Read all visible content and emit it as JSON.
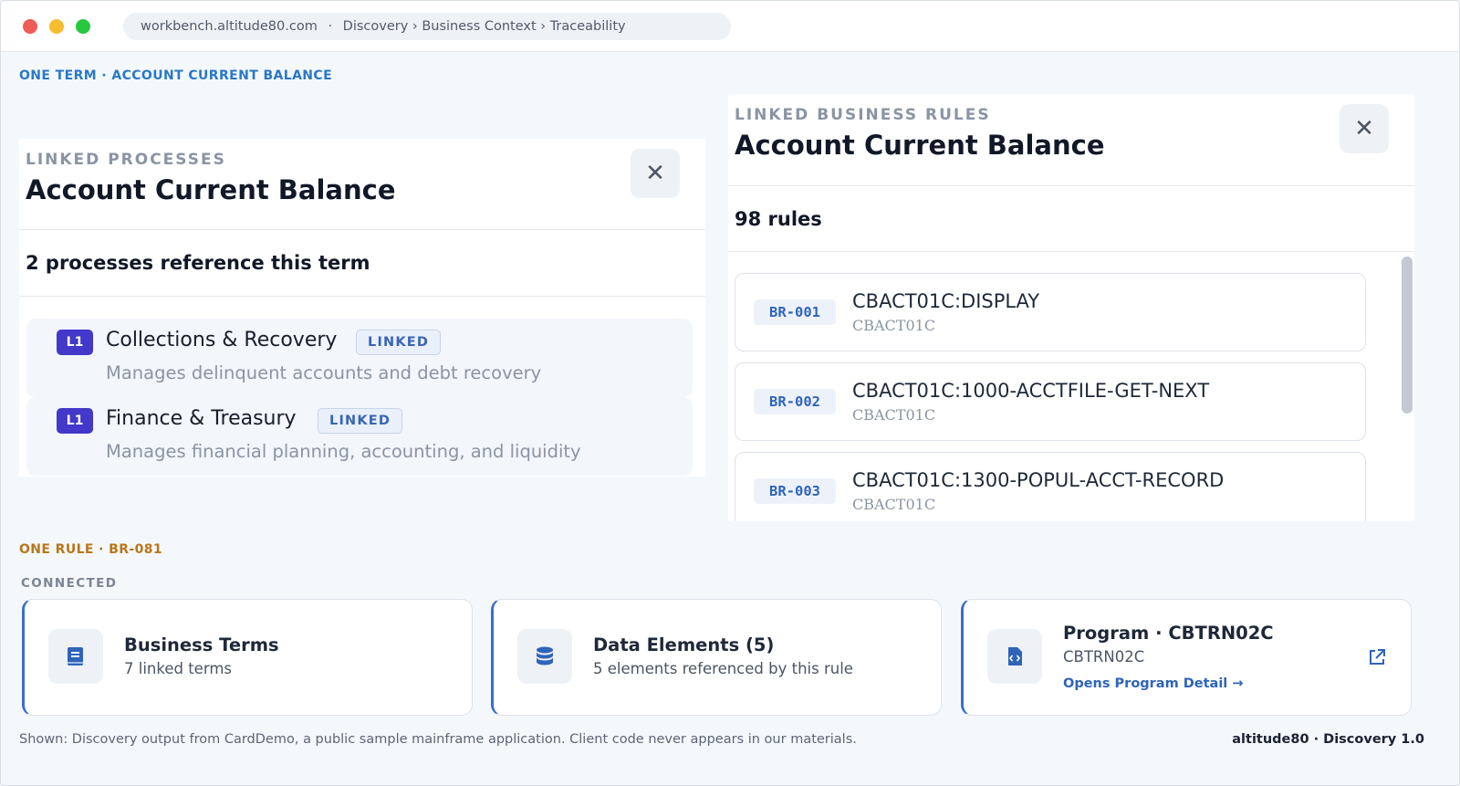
{
  "window": {
    "url": "workbench.altitude80.com",
    "separator": "·",
    "breadcrumb": "Discovery › Business Context › Traceability"
  },
  "term_section": {
    "label": "ONE TERM · ACCOUNT CURRENT BALANCE"
  },
  "processes_panel": {
    "eyebrow": "LINKED PROCESSES",
    "title": "Account Current Balance",
    "close": "✕",
    "count": "2 processes reference this term",
    "items": [
      {
        "level": "L1",
        "name": "Collections & Recovery",
        "badge": "LINKED",
        "description": "Manages delinquent accounts and debt recovery"
      },
      {
        "level": "L1",
        "name": "Finance & Treasury",
        "badge": "LINKED",
        "description": "Manages financial planning, accounting, and liquidity"
      }
    ]
  },
  "rules_panel": {
    "eyebrow": "LINKED BUSINESS RULES",
    "title": "Account Current Balance",
    "close": "✕",
    "count": "98 rules",
    "items": [
      {
        "id": "BR-001",
        "name": "CBACT01C:DISPLAY",
        "program": "CBACT01C"
      },
      {
        "id": "BR-002",
        "name": "CBACT01C:1000-ACCTFILE-GET-NEXT",
        "program": "CBACT01C"
      },
      {
        "id": "BR-003",
        "name": "CBACT01C:1300-POPUL-ACCT-RECORD",
        "program": "CBACT01C"
      }
    ]
  },
  "rule_section": {
    "label": "ONE RULE · BR-081",
    "connected_label": "CONNECTED",
    "cards": [
      {
        "icon": "book-icon",
        "title": "Business Terms",
        "subtitle": "7 linked terms"
      },
      {
        "icon": "database-icon",
        "title": "Data Elements (5)",
        "subtitle": "5 elements referenced by this rule"
      },
      {
        "icon": "code-file-icon",
        "title": "Program · CBTRN02C",
        "subtitle": "CBTRN02C",
        "link": "Opens Program Detail →"
      }
    ]
  },
  "footer": {
    "note": "Shown: Discovery output from CardDemo, a public sample mainframe application. Client code never appears in our materials.",
    "brand": "altitude80 · Discovery 1.0"
  },
  "colors": {
    "accent": "#2f64b8",
    "level_badge": "#4338ca",
    "term_label": "#2878c8",
    "rule_label": "#b8761a"
  }
}
